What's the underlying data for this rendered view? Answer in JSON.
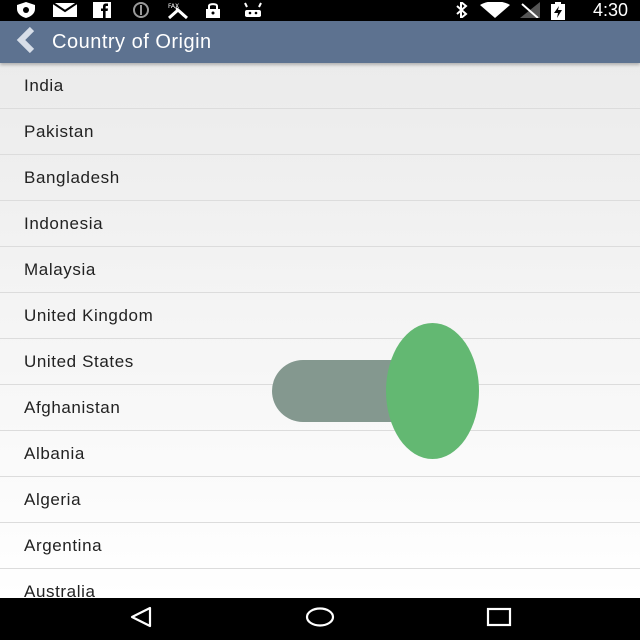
{
  "status_bar": {
    "time": "4:30",
    "left_icons": [
      "shield-icon",
      "mail-icon",
      "facebook-icon",
      "blocked-icon",
      "fax-icon",
      "lock-icon",
      "android-icon"
    ],
    "right_icons": [
      "bluetooth-icon",
      "wifi-icon",
      "no-signal-icon",
      "battery-charging-icon"
    ]
  },
  "toolbar": {
    "title": "Country of Origin",
    "back_icon": "chevron-left-icon"
  },
  "countries": [
    "India",
    "Pakistan",
    "Bangladesh",
    "Indonesia",
    "Malaysia",
    "United Kingdom",
    "United States",
    "Afghanistan",
    "Albania",
    "Algeria",
    "Argentina",
    "Australia"
  ],
  "overlay": {
    "icon": "drag-handle-icon",
    "bar_color": "#84988f",
    "knob_color": "#63b872"
  },
  "nav_bar": {
    "icons": [
      "back-triangle-icon",
      "home-circle-icon",
      "recents-square-icon"
    ]
  },
  "colors": {
    "toolbar": "#5d7290",
    "status_bar": "#000000",
    "list_text": "#222222"
  }
}
